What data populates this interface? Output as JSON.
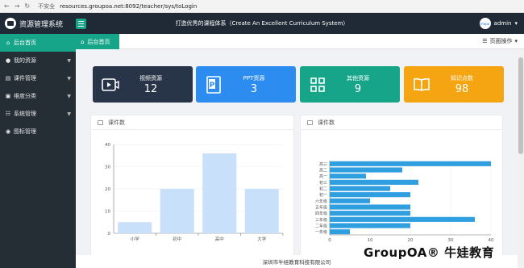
{
  "browser": {
    "secure_label": "不安全",
    "url": "resources.groupoa.net:8092/teacher/sys/toLogin"
  },
  "header": {
    "app_title": "资源管理系统",
    "slogan": "打造优秀的课程体系（Create An Excellent Curriculum System）",
    "username": "admin",
    "avatar_text": "mepa"
  },
  "sidebar": {
    "items": [
      {
        "label": "后台首页",
        "icon": "home-icon"
      },
      {
        "label": "我的资源",
        "icon": "user-icon"
      },
      {
        "label": "课件管理",
        "icon": "courseware-icon"
      },
      {
        "label": "维度分类",
        "icon": "category-icon"
      },
      {
        "label": "系统管理",
        "icon": "system-icon"
      },
      {
        "label": "图标管理",
        "icon": "icon-manage-icon"
      }
    ]
  },
  "tabs": {
    "home_label": "后台首页",
    "page_op_label": "页面操作"
  },
  "cards": [
    {
      "label": "视频资源",
      "value": "12",
      "color": "#283447",
      "icon": "video-icon"
    },
    {
      "label": "PPT资源",
      "value": "3",
      "color": "#2d8cf0",
      "icon": "ppt-icon"
    },
    {
      "label": "其他资源",
      "value": "9",
      "color": "#17a58a",
      "icon": "grid-icon"
    },
    {
      "label": "知识点数",
      "value": "98",
      "color": "#f5a511",
      "icon": "book-icon"
    }
  ],
  "panels": {
    "left_title": "课件数",
    "right_title": "课件数"
  },
  "chart_data": [
    {
      "type": "bar",
      "categories": [
        "小学",
        "初中",
        "高中",
        "大学"
      ],
      "values": [
        5,
        20,
        36,
        20
      ],
      "ylim": [
        0,
        40
      ],
      "yticks": [
        0,
        10,
        20,
        30,
        40
      ],
      "color": "#c8e0fa"
    },
    {
      "type": "bar",
      "orientation": "horizontal",
      "categories": [
        "一年级",
        "二年级",
        "三年级",
        "四年级",
        "五年级",
        "六年级",
        "初一",
        "初二",
        "初三",
        "高一",
        "高二",
        "高三"
      ],
      "values": [
        5,
        20,
        36,
        20,
        20,
        10,
        20,
        15,
        22,
        9,
        18,
        40
      ],
      "xlim": [
        0,
        40
      ],
      "xticks": [
        0,
        10,
        20,
        30,
        40
      ],
      "color": "#2f9fe0"
    }
  ],
  "footer": {
    "text": "深圳市牛娃教育科技有限公司"
  },
  "watermark": {
    "text": "GroupOA® 牛娃教育"
  }
}
